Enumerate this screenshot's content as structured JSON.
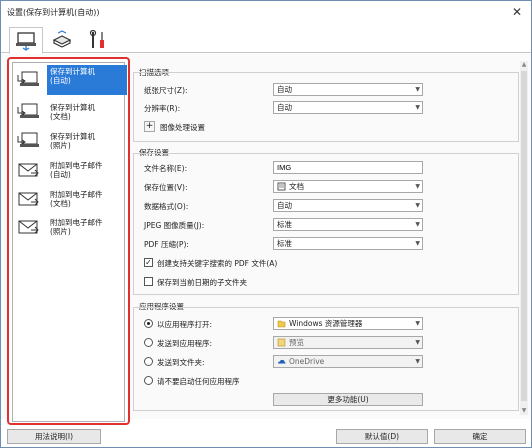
{
  "window": {
    "title": "设置(保存到计算机(自动))",
    "close_glyph": "✕"
  },
  "tabs": [
    {
      "icon": "scan-to-computer-icon"
    },
    {
      "icon": "scanner-icon"
    },
    {
      "icon": "tools-icon"
    }
  ],
  "sidebar": {
    "items": [
      {
        "label": "保存到计算机\n(自动)",
        "icon": "save-to-computer-icon"
      },
      {
        "label": "保存到计算机\n(文档)",
        "icon": "save-to-computer-icon"
      },
      {
        "label": "保存到计算机\n(照片)",
        "icon": "save-to-computer-icon"
      },
      {
        "label": "附加到电子邮件\n(自动)",
        "icon": "attach-email-icon"
      },
      {
        "label": "附加到电子邮件\n(文档)",
        "icon": "attach-email-icon"
      },
      {
        "label": "附加到电子邮件\n(照片)",
        "icon": "attach-email-icon"
      }
    ]
  },
  "scan_options": {
    "heading": "扫描选项",
    "paper_size_label": "纸张尺寸(Z):",
    "paper_size_value": "自动",
    "resolution_label": "分辨率(R):",
    "resolution_value": "自动",
    "image_processing_label": "图像处理设置",
    "plus": "+"
  },
  "save_settings": {
    "heading": "保存设置",
    "filename_label": "文件名称(E):",
    "filename_value": "IMG",
    "save_in_label": "保存位置(V):",
    "save_in_value": "文档",
    "data_format_label": "数据格式(O):",
    "data_format_value": "自动",
    "jpeg_quality_label": "JPEG 图像质量(J):",
    "jpeg_quality_value": "标准",
    "pdf_compression_label": "PDF 压缩(P):",
    "pdf_compression_value": "标准",
    "keyword_pdf_label": "创建支持关键字搜索的 PDF 文件(A)",
    "keyword_pdf_checked": true,
    "subfolder_label": "保存到当前日期的子文件夹",
    "subfolder_checked": false,
    "check_glyph": "✓"
  },
  "app_settings": {
    "heading": "应用程序设置",
    "options": [
      {
        "label": "以应用程序打开:",
        "value": "Windows 资源管理器",
        "selected": true,
        "enabled": true
      },
      {
        "label": "发送到应用程序:",
        "value": "预览",
        "selected": false,
        "enabled": false
      },
      {
        "label": "发送到文件夹:",
        "value": "OneDrive",
        "selected": false,
        "enabled": false
      },
      {
        "label": "请不要启动任何应用程序",
        "value": "",
        "selected": false,
        "enabled": true
      }
    ],
    "more_functions_label": "更多功能(U)"
  },
  "footer": {
    "instructions_label": "用法说明(I)",
    "defaults_label": "默认值(D)",
    "ok_label": "确定"
  },
  "colors": {
    "accent": "#2a7ad8",
    "highlight_border": "#e03030"
  }
}
